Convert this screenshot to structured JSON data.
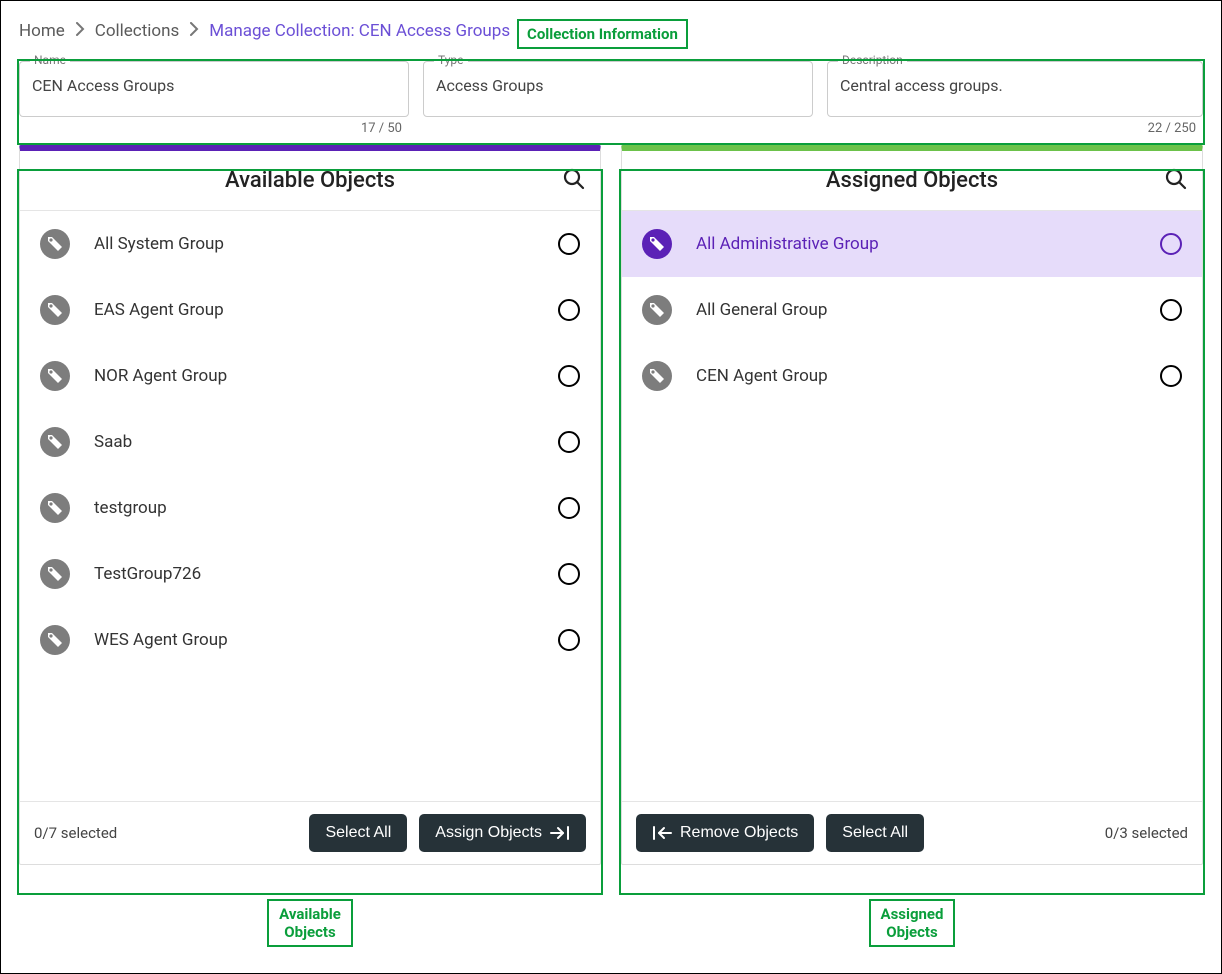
{
  "breadcrumb": {
    "home": "Home",
    "collections": "Collections",
    "current": "Manage Collection: CEN Access Groups"
  },
  "annotations": {
    "collection_info": "Collection Information",
    "available_objects": "Available Objects",
    "assigned_objects": "Assigned Objects"
  },
  "info": {
    "name_label": "Name",
    "name_value": "CEN Access Groups",
    "name_counter": "17 / 50",
    "type_label": "Type",
    "type_value": "Access Groups",
    "desc_label": "Description",
    "desc_value": "Central access groups.",
    "desc_counter": "22 / 250"
  },
  "available": {
    "title": "Available Objects",
    "selected_text": "0/7 selected",
    "select_all": "Select All",
    "assign": "Assign Objects",
    "items": [
      {
        "name": "All System Group"
      },
      {
        "name": "EAS Agent Group"
      },
      {
        "name": "NOR Agent Group"
      },
      {
        "name": "Saab"
      },
      {
        "name": "testgroup"
      },
      {
        "name": "TestGroup726"
      },
      {
        "name": "WES Agent Group"
      }
    ]
  },
  "assigned": {
    "title": "Assigned Objects",
    "selected_text": "0/3 selected",
    "select_all": "Select All",
    "remove": "Remove Objects",
    "items": [
      {
        "name": "All Administrative Group",
        "highlight": true
      },
      {
        "name": "All General Group"
      },
      {
        "name": "CEN Agent Group"
      }
    ]
  }
}
